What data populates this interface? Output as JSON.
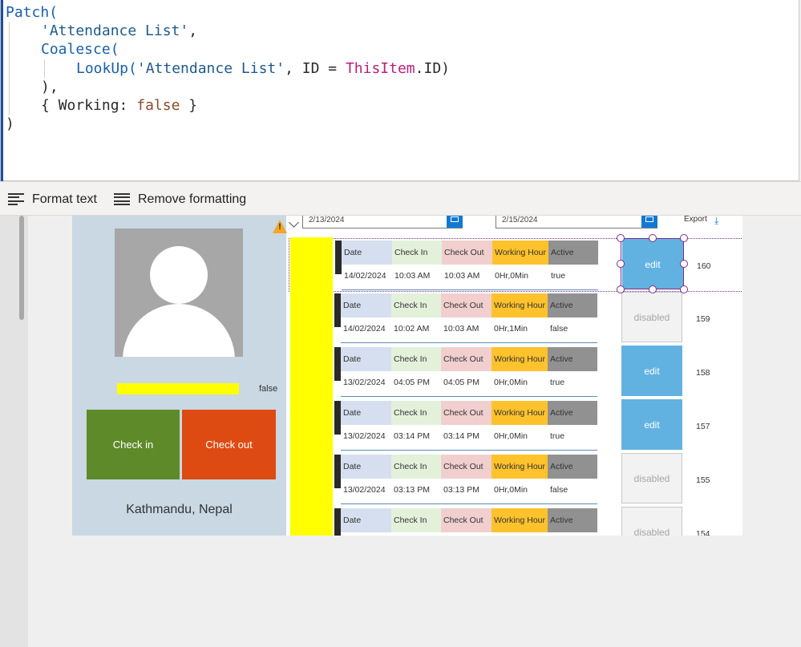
{
  "editor": {
    "code": {
      "l1_fn": "Patch(",
      "l2_str": "'Attendance List'",
      "l2_punct": ",",
      "l3_fn": "Coalesce(",
      "l4_fn": "LookUp(",
      "l4_str": "'Attendance List'",
      "l4_mid": ", ID = ",
      "l4_kw": "ThisItem",
      "l4_end": ".ID)",
      "l5": "),",
      "l6_open": "{ ",
      "l6_key": "Working: ",
      "l6_val": "false",
      "l6_close": " }",
      "l7": ")"
    }
  },
  "toolbar": {
    "format_text": "Format text",
    "remove_formatting": "Remove formatting"
  },
  "app": {
    "date_from": "2/13/2024",
    "date_to": "2/15/2024",
    "export_label": "Export",
    "warning_mark": "!",
    "user_status": "false",
    "checkin_label": "Check in",
    "checkout_label": "Check out",
    "location": "Kathmandu, Nepal",
    "headers": {
      "date": "Date",
      "check_in": "Check In",
      "check_out": "Check Out",
      "working_hour": "Working Hour",
      "active": "Active"
    },
    "rows": [
      {
        "date": "14/02/2024",
        "check_in": "10:03 AM",
        "check_out": "10:03 AM",
        "working": "0Hr,0Min",
        "active": "true",
        "button": "edit",
        "id": "160"
      },
      {
        "date": "14/02/2024",
        "check_in": "10:02 AM",
        "check_out": "10:03 AM",
        "working": "0Hr,1Min",
        "active": "false",
        "button": "disabled",
        "id": "159"
      },
      {
        "date": "13/02/2024",
        "check_in": "04:05 PM",
        "check_out": "04:05 PM",
        "working": "0Hr,0Min",
        "active": "true",
        "button": "edit",
        "id": "158"
      },
      {
        "date": "13/02/2024",
        "check_in": "03:14 PM",
        "check_out": "03:14 PM",
        "working": "0Hr,0Min",
        "active": "true",
        "button": "edit",
        "id": "157"
      },
      {
        "date": "13/02/2024",
        "check_in": "03:13 PM",
        "check_out": "03:13 PM",
        "working": "0Hr,0Min",
        "active": "false",
        "button": "disabled",
        "id": "155"
      },
      {
        "date": "",
        "check_in": "",
        "check_out": "",
        "working": "",
        "active": "",
        "button": "disabled",
        "id": "154"
      }
    ]
  },
  "colors": {
    "edit_button": "#62b2e1",
    "checkin": "#5e8a2a",
    "checkout": "#dd4b12",
    "selection": "#7b2c8c",
    "highlight": "#ffff00"
  }
}
